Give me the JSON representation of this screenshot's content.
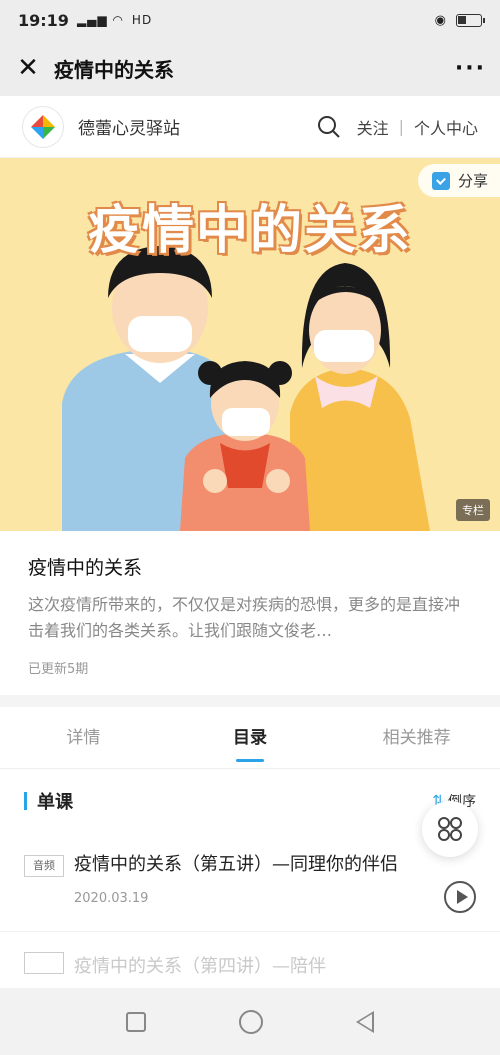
{
  "status_bar": {
    "time": "19:19",
    "signal": "46",
    "network": "HD"
  },
  "nav": {
    "title": "疫情中的关系",
    "more": "···"
  },
  "shop": {
    "name": "德蕾心灵驿站",
    "follow": "关注",
    "profile": "个人中心"
  },
  "banner": {
    "title": "疫情中的关系",
    "share": "分享",
    "tag": "专栏"
  },
  "course": {
    "title": "疫情中的关系",
    "description": "这次疫情所带来的，不仅仅是对疾病的恐惧，更多的是直接冲击着我们的各类关系。让我们跟随文俊老…",
    "updated": "已更新5期"
  },
  "tabs": [
    {
      "label": "详情"
    },
    {
      "label": "目录"
    },
    {
      "label": "相关推荐"
    }
  ],
  "section": {
    "title": "单课",
    "sort": "倒序"
  },
  "lessons": [
    {
      "type": "音频",
      "title": "疫情中的关系（第五讲）—同理你的伴侣",
      "date": "2020.03.19"
    },
    {
      "title": "疫情中的关系（第四讲）—陪伴"
    }
  ],
  "colors": {
    "accent": "#2aa3e8",
    "banner_bg": "#fbe6a6"
  }
}
